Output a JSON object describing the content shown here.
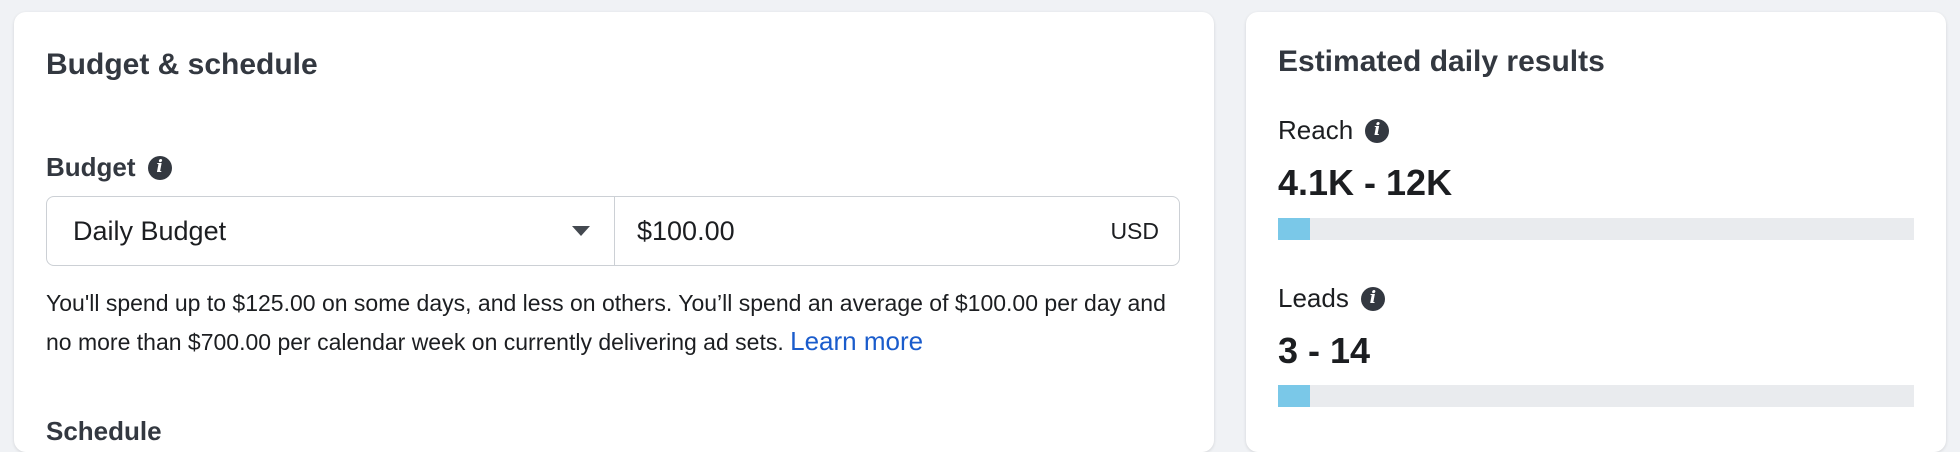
{
  "budget_schedule": {
    "title": "Budget & schedule",
    "budget_label": "Budget",
    "budget_type": "Daily Budget",
    "amount": "$100.00",
    "currency": "USD",
    "help_text": "You'll spend up to $125.00 on some days, and less on others. You’ll spend an average of $100.00 per day and no more than $700.00 per calendar week on currently delivering ad sets.",
    "learn_more": "Learn more",
    "schedule_label": "Schedule"
  },
  "estimated_results": {
    "title": "Estimated daily results",
    "reach": {
      "label": "Reach",
      "value": "4.1K - 12K",
      "bar_fill_fraction": 0.05
    },
    "leads": {
      "label": "Leads",
      "value": "3 - 14",
      "bar_fill_fraction": 0.05
    }
  },
  "colors": {
    "link": "#1a5ccc",
    "bar_fill": "#7ac8e8",
    "bar_track": "#e9ebee"
  }
}
